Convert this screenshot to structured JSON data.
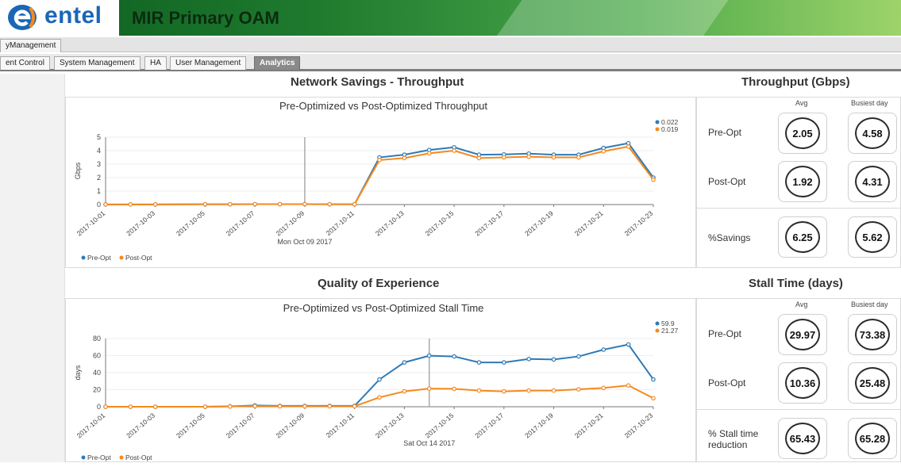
{
  "header": {
    "logo_text": "entel",
    "title": "MIR Primary OAM"
  },
  "top_tab": "yManagement",
  "tabs": [
    "ent Control",
    "System Management",
    "HA",
    "User Management",
    "Analytics"
  ],
  "active_tab": "Analytics",
  "sections": {
    "network_savings": "Network Savings - Throughput",
    "throughput_gbps": "Throughput (Gbps)",
    "qoe": "Quality of Experience",
    "stall_time": "Stall Time (days)"
  },
  "throughput_stats": {
    "col_avg": "Avg",
    "col_busiest": "Busiest day",
    "rows": [
      {
        "label": "Pre-Opt",
        "avg": "2.05",
        "busiest": "4.58"
      },
      {
        "label": "Post-Opt",
        "avg": "1.92",
        "busiest": "4.31"
      },
      {
        "label": "%Savings",
        "avg": "6.25",
        "busiest": "5.62"
      }
    ]
  },
  "stall_stats": {
    "col_avg": "Avg",
    "col_busiest": "Busiest day",
    "rows": [
      {
        "label": "Pre-Opt",
        "avg": "29.97",
        "busiest": "73.38"
      },
      {
        "label": "Post-Opt",
        "avg": "10.36",
        "busiest": "25.48"
      },
      {
        "label": "% Stall time reduction",
        "avg": "65.43",
        "busiest": "65.28"
      }
    ]
  },
  "chart_data": [
    {
      "type": "line",
      "title": "Pre-Optimized vs Post-Optimized Throughput",
      "ylabel": "Gbps",
      "ylim": [
        0,
        5
      ],
      "yticks": [
        "0",
        "1",
        "2",
        "3",
        "4",
        "5"
      ],
      "x": [
        "2017-10-01",
        "2017-10-02",
        "2017-10-03",
        "2017-10-05",
        "2017-10-06",
        "2017-10-07",
        "2017-10-08",
        "2017-10-09",
        "2017-10-10",
        "2017-10-11",
        "2017-10-12",
        "2017-10-13",
        "2017-10-14",
        "2017-10-15",
        "2017-10-16",
        "2017-10-17",
        "2017-10-18",
        "2017-10-19",
        "2017-10-20",
        "2017-10-21",
        "2017-10-22",
        "2017-10-23"
      ],
      "xtick_labels": [
        "2017-10-01",
        "2017-10-03",
        "2017-10-05",
        "2017-10-07",
        "2017-10-09",
        "2017-10-11",
        "2017-10-13",
        "2017-10-15",
        "2017-10-17",
        "2017-10-19",
        "2017-10-21",
        "2017-10-23"
      ],
      "series": [
        {
          "name": "Pre-Opt",
          "color": "#2e7ab8",
          "values": [
            0.01,
            0.01,
            0.01,
            0.02,
            0.02,
            0.03,
            0.03,
            0.03,
            0.02,
            0.02,
            3.5,
            3.7,
            4.05,
            4.25,
            3.7,
            3.72,
            3.78,
            3.7,
            3.7,
            4.2,
            4.55,
            2.0
          ]
        },
        {
          "name": "Post-Opt",
          "color": "#f5891f",
          "values": [
            0.01,
            0.01,
            0.01,
            0.02,
            0.02,
            0.03,
            0.03,
            0.03,
            0.02,
            0.02,
            3.3,
            3.45,
            3.8,
            4.0,
            3.45,
            3.5,
            3.55,
            3.5,
            3.5,
            3.95,
            4.3,
            1.85
          ]
        }
      ],
      "hover_marker": "2017-10-09",
      "hover_label": "Mon Oct 09 2017",
      "tooltip_values": [
        "0.022",
        "0.019"
      ],
      "legend": [
        "Pre-Opt",
        "Post-Opt"
      ],
      "legend_position": "bottom-left"
    },
    {
      "type": "line",
      "title": "Pre-Optimized vs Post-Optimized Stall Time",
      "ylabel": "days",
      "ylim": [
        0,
        80
      ],
      "yticks": [
        "0",
        "20",
        "40",
        "60",
        "80"
      ],
      "x": [
        "2017-10-01",
        "2017-10-02",
        "2017-10-03",
        "2017-10-05",
        "2017-10-06",
        "2017-10-07",
        "2017-10-08",
        "2017-10-09",
        "2017-10-10",
        "2017-10-11",
        "2017-10-12",
        "2017-10-13",
        "2017-10-14",
        "2017-10-15",
        "2017-10-16",
        "2017-10-17",
        "2017-10-18",
        "2017-10-19",
        "2017-10-20",
        "2017-10-21",
        "2017-10-22",
        "2017-10-23"
      ],
      "xtick_labels": [
        "2017-10-01",
        "2017-10-03",
        "2017-10-05",
        "2017-10-07",
        "2017-10-09",
        "2017-10-11",
        "2017-10-13",
        "2017-10-15",
        "2017-10-17",
        "2017-10-19",
        "2017-10-21",
        "2017-10-23"
      ],
      "series": [
        {
          "name": "Pre-Opt",
          "color": "#2e7ab8",
          "values": [
            0,
            0,
            0,
            0,
            0.5,
            1.5,
            1,
            1,
            1,
            1,
            32,
            52,
            59.9,
            59,
            52,
            52,
            56,
            55.5,
            59,
            67,
            73,
            32
          ]
        },
        {
          "name": "Post-Opt",
          "color": "#f5891f",
          "values": [
            0,
            0,
            0,
            0,
            0.3,
            0.8,
            0.6,
            0.6,
            0.6,
            0.6,
            11,
            18,
            21.27,
            21,
            19,
            18,
            19,
            19,
            20.5,
            22,
            25,
            10
          ]
        }
      ],
      "hover_marker": "2017-10-14",
      "hover_label": "Sat Oct 14 2017",
      "tooltip_values": [
        "59.9",
        "21.27"
      ],
      "legend": [
        "Pre-Opt",
        "Post-Opt"
      ],
      "legend_position": "bottom-left"
    }
  ]
}
